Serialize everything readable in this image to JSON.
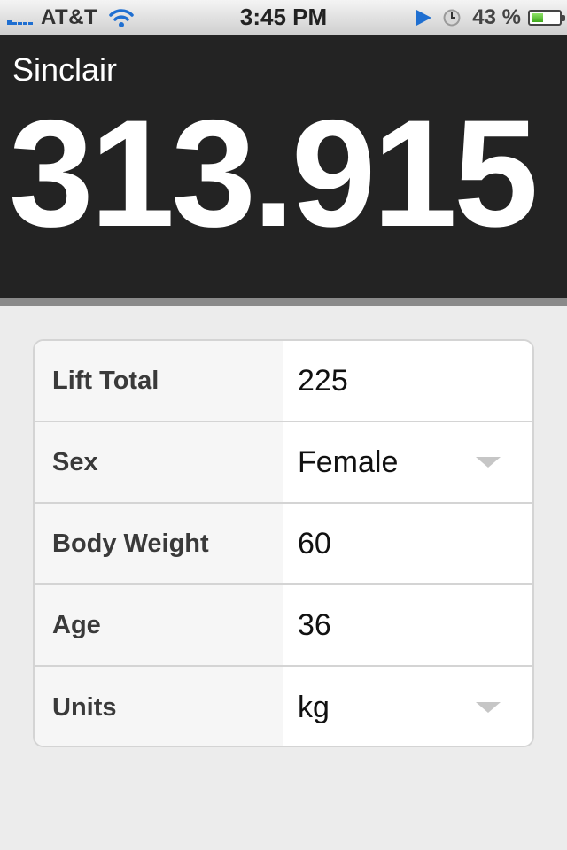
{
  "status_bar": {
    "carrier": "AT&T",
    "time": "3:45 PM",
    "battery_percent": "43 %",
    "battery_level": 0.43,
    "icons": [
      "signal-icon",
      "wifi-icon",
      "location-icon",
      "clock-icon",
      "battery-icon"
    ]
  },
  "result": {
    "label": "Sinclair",
    "value": "313.915"
  },
  "form": {
    "rows": [
      {
        "label": "Lift Total",
        "value": "225",
        "type": "input"
      },
      {
        "label": "Sex",
        "value": "Female",
        "type": "select"
      },
      {
        "label": "Body Weight",
        "value": "60",
        "type": "input"
      },
      {
        "label": "Age",
        "value": "36",
        "type": "input"
      },
      {
        "label": "Units",
        "value": "kg",
        "type": "select"
      }
    ]
  },
  "colors": {
    "header_bg": "#232323",
    "page_bg": "#ececec",
    "signal_blue": "#1f6fd1",
    "battery_green": "#3fa81c"
  }
}
